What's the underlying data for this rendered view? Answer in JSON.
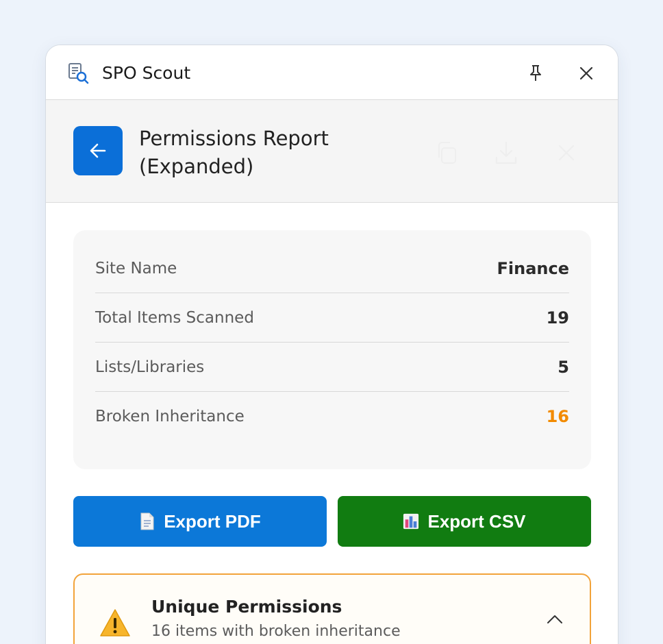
{
  "app": {
    "title": "SPO Scout"
  },
  "subheader": {
    "title": "Permissions Report (Expanded)"
  },
  "stats": [
    {
      "label": "Site Name",
      "value": "Finance"
    },
    {
      "label": "Total Items Scanned",
      "value": "19"
    },
    {
      "label": "Lists/Libraries",
      "value": "5"
    },
    {
      "label": "Broken Inheritance",
      "value": "16"
    }
  ],
  "buttons": {
    "export_pdf": "Export PDF",
    "export_csv": "Export CSV"
  },
  "section": {
    "title": "Unique Permissions",
    "subtitle": "16 items with broken inheritance"
  },
  "colors": {
    "accent": "#0b6fd8",
    "csv_green": "#117c11",
    "warning": "#f28a00",
    "section_border": "#f2a33a"
  },
  "icons": [
    "app-search-document-icon",
    "pin-icon",
    "close-icon",
    "arrow-left-icon",
    "copy-icon",
    "download-icon",
    "dismiss-icon",
    "document-icon",
    "bar-chart-icon",
    "warning-icon",
    "chevron-up-icon"
  ]
}
